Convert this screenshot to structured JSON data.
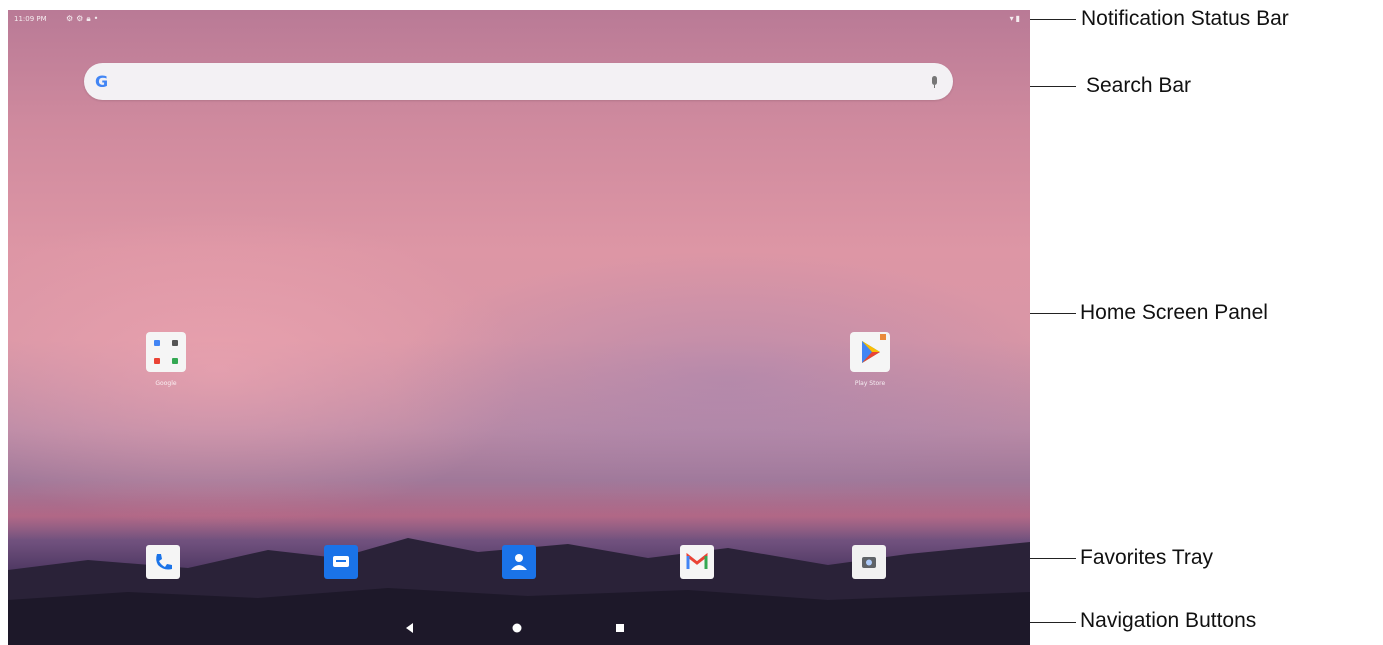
{
  "status_bar": {
    "time": "11:09 PM",
    "left_icons": [
      "settings-icon",
      "settings-icon",
      "lock-icon",
      "notification-dot-icon"
    ],
    "right_icons": [
      "wifi-icon",
      "battery-icon"
    ]
  },
  "search_bar": {
    "logo": "G",
    "mic_icon": "mic-icon"
  },
  "home_apps": [
    {
      "label": "Google",
      "icon": "folder-icon"
    },
    {
      "label": "Play Store",
      "icon": "play-store-icon"
    }
  ],
  "favorites_tray": [
    {
      "icon": "phone-icon"
    },
    {
      "icon": "messages-icon"
    },
    {
      "icon": "contacts-icon"
    },
    {
      "icon": "gmail-icon"
    },
    {
      "icon": "camera-icon"
    }
  ],
  "nav_buttons": [
    {
      "icon": "back-icon"
    },
    {
      "icon": "home-icon"
    },
    {
      "icon": "recents-icon"
    }
  ],
  "callouts": {
    "status_bar": "Notification Status Bar",
    "search_bar": "Search Bar",
    "home_panel": "Home Screen Panel",
    "favorites": "Favorites Tray",
    "navigation": "Navigation Buttons"
  },
  "colors": {
    "google_blue": "#4285f4",
    "phone_blue": "#1a73e8",
    "messages_blue": "#1a73e8",
    "contacts_blue": "#1a73e8",
    "gmail_red": "#ea4335"
  }
}
